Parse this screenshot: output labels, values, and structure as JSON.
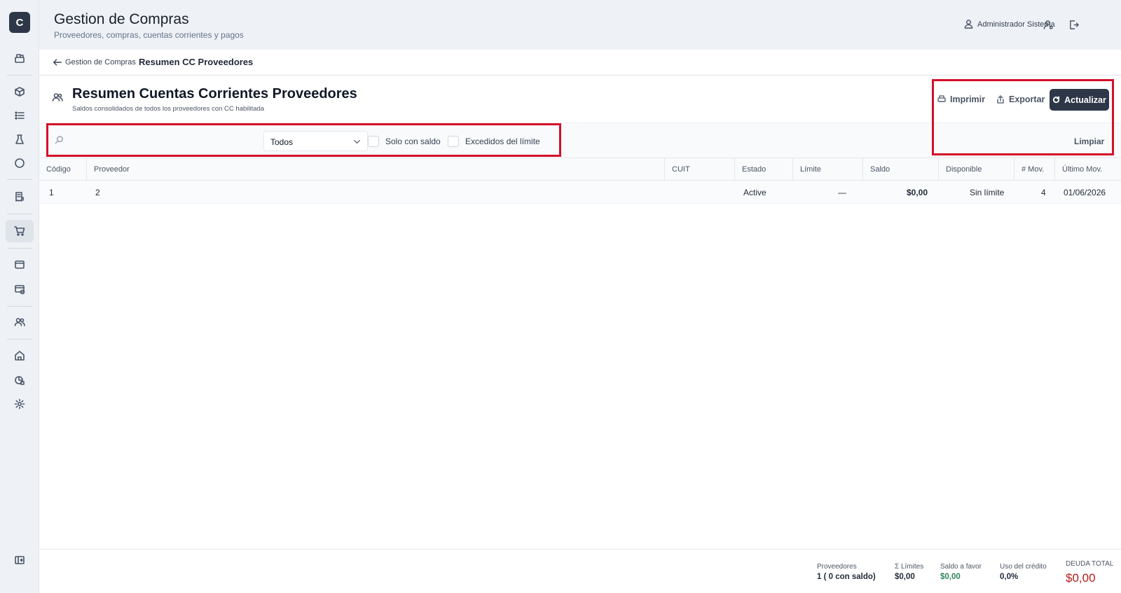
{
  "app": {
    "logo_letter": "C"
  },
  "header": {
    "title": "Gestion de Compras",
    "subtitle": "Proveedores, compras, cuentas corrientes y pagos",
    "user_name": "Administrador Sistema"
  },
  "sidebar": {
    "items": [
      "cash-register-icon",
      "box-icon",
      "list-icon",
      "flask-icon",
      "circle-icon",
      "receipt-icon",
      "cart-icon",
      "wallet-icon",
      "card-icon",
      "users-icon",
      "home-icon",
      "chart-icon",
      "gear-icon",
      "collapse-icon"
    ],
    "active": "cart-icon"
  },
  "breadcrumb": {
    "back_label": "Gestion de Compras",
    "current": "Resumen CC Proveedores"
  },
  "page": {
    "title": "Resumen Cuentas Corrientes Proveedores",
    "subtitle": "Saldos consolidados de todos los proveedores con CC habilitada"
  },
  "actions": {
    "print_label": "Imprimir",
    "export_label": "Exportar",
    "refresh_label": "Actualizar",
    "clear_label": "Limpiar"
  },
  "filters": {
    "search_value": "",
    "search_placeholder": "",
    "status_selected": "Todos",
    "only_balance_label": "Solo con saldo",
    "exceeded_label": "Excedidos del límite"
  },
  "table": {
    "columns": [
      "Código",
      "Proveedor",
      "CUIT",
      "Estado",
      "Límite",
      "Saldo",
      "Disponible",
      "# Mov.",
      "Último Mov."
    ],
    "rows": [
      {
        "codigo": "1",
        "proveedor": "2",
        "cuit": "",
        "estado": "Active",
        "limite": "—",
        "saldo": "$0,00",
        "disponible": "Sin límite",
        "movs": "4",
        "ultimo": "01/06/2026"
      }
    ]
  },
  "footer": {
    "proveedores_label": "Proveedores",
    "proveedores_value": "1  ( 0  con saldo)",
    "limites_label": "Σ Límites",
    "limites_value": "$0,00",
    "saldo_favor_label": "Saldo a favor",
    "saldo_favor_value": "$0,00",
    "uso_credito_label": "Uso del crédito",
    "uso_credito_value": "0,0%",
    "deuda_label": "DEUDA TOTAL",
    "deuda_value": "$0,00"
  },
  "colors": {
    "primary": "#2d3748",
    "highlight_box": "#d40f2a",
    "debt": "#b91c1c",
    "positive": "#2f855a"
  }
}
